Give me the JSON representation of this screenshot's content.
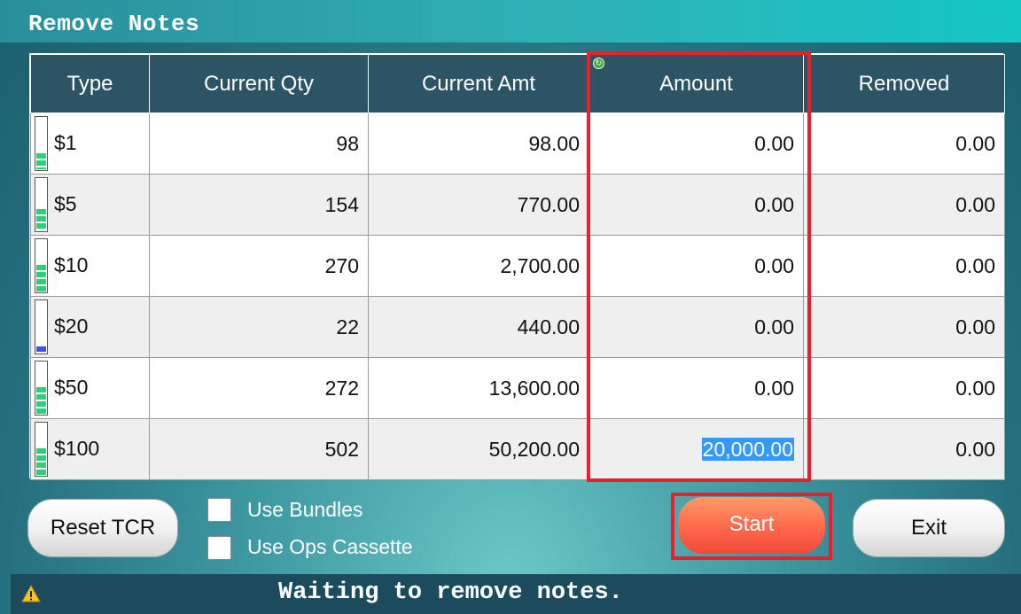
{
  "window": {
    "title": "Remove Notes"
  },
  "table": {
    "headers": {
      "type": "Type",
      "current_qty": "Current Qty",
      "current_amt": "Current Amt",
      "amount": "Amount",
      "removed": "Removed"
    },
    "rows": [
      {
        "type": "$1",
        "current_qty": "98",
        "current_amt": "98.00",
        "amount": "0.00",
        "removed": "0.00",
        "level": 0.3,
        "level_color": "#2fcf7a"
      },
      {
        "type": "$5",
        "current_qty": "154",
        "current_amt": "770.00",
        "amount": "0.00",
        "removed": "0.00",
        "level": 0.4,
        "level_color": "#2fcf7a"
      },
      {
        "type": "$10",
        "current_qty": "270",
        "current_amt": "2,700.00",
        "amount": "0.00",
        "removed": "0.00",
        "level": 0.5,
        "level_color": "#2fcf7a"
      },
      {
        "type": "$20",
        "current_qty": "22",
        "current_amt": "440.00",
        "amount": "0.00",
        "removed": "0.00",
        "level": 0.12,
        "level_color": "#3a55e8"
      },
      {
        "type": "$50",
        "current_qty": "272",
        "current_amt": "13,600.00",
        "amount": "0.00",
        "removed": "0.00",
        "level": 0.5,
        "level_color": "#2fcf7a"
      },
      {
        "type": "$100",
        "current_qty": "502",
        "current_amt": "50,200.00",
        "amount": "20,000.00",
        "removed": "0.00",
        "level": 0.5,
        "level_color": "#2fcf7a",
        "amount_selected": true
      }
    ]
  },
  "options": {
    "use_bundles": {
      "label": "Use Bundles",
      "checked": false
    },
    "use_ops_cassette": {
      "label": "Use Ops Cassette",
      "checked": false
    }
  },
  "buttons": {
    "reset": "Reset TCR",
    "start": "Start",
    "exit": "Exit"
  },
  "status": {
    "icon": "warning-icon",
    "text": "Waiting to remove notes."
  },
  "colors": {
    "highlight": "#e8202a",
    "header_bg": "#2c5465",
    "start_button": "#ff6b4c"
  }
}
